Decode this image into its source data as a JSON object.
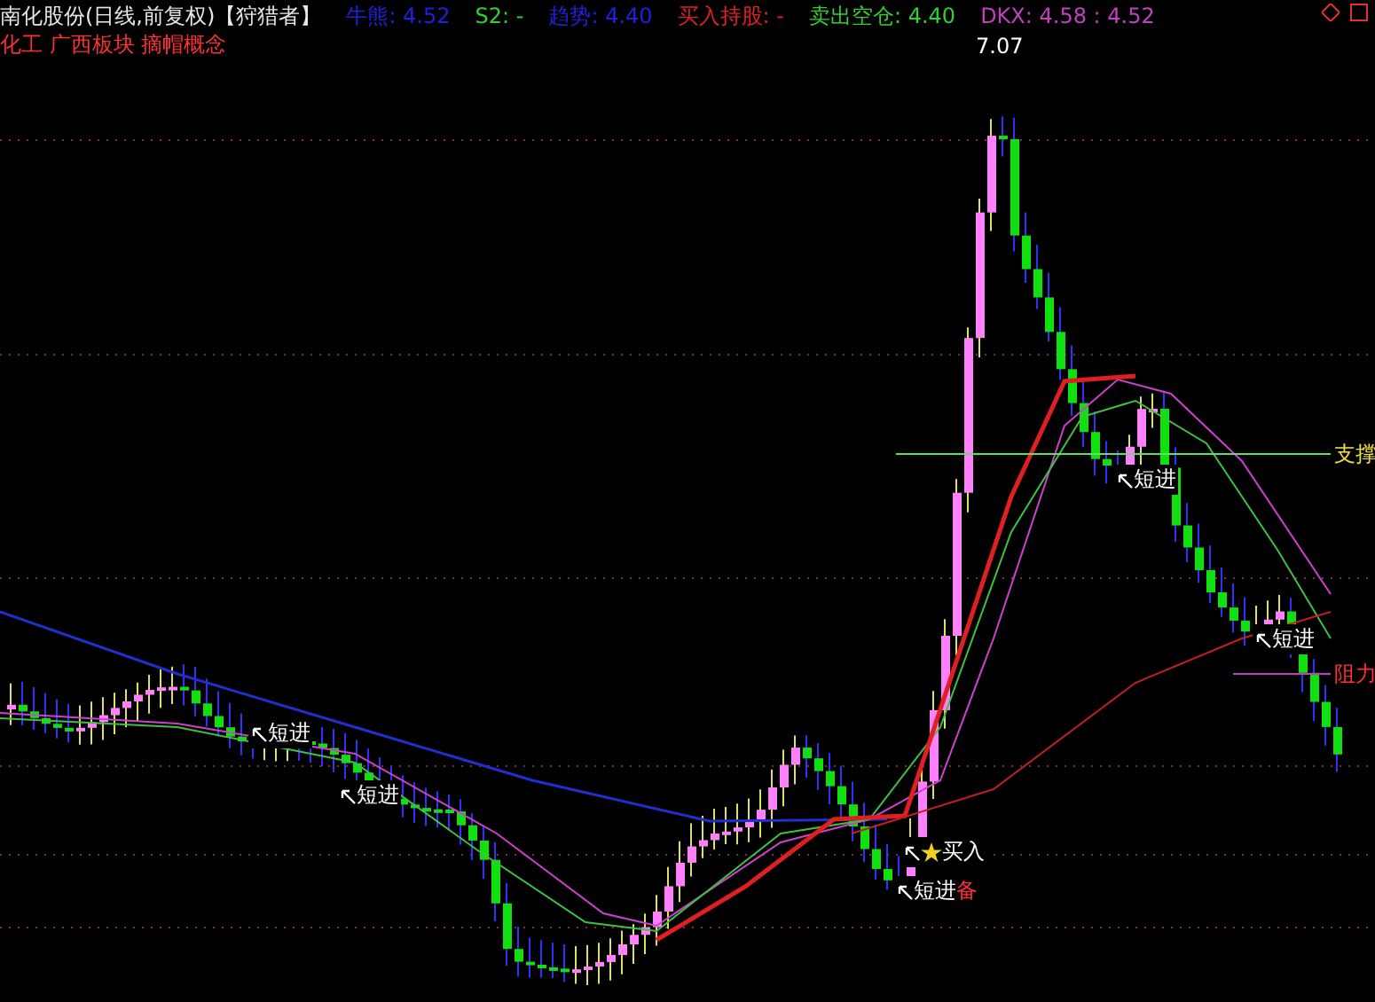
{
  "header": {
    "title": "南化股份(日线,前复权)【狩猎者】",
    "indicators": [
      {
        "label": "牛熊: 4.52",
        "color": "#2020e0"
      },
      {
        "label": "S2: -",
        "color": "#30d030"
      },
      {
        "label": "趋势: 4.40",
        "color": "#2020e0"
      },
      {
        "label": "买入持股: -",
        "color": "#e02020"
      },
      {
        "label": "卖出空仓: 4.40",
        "color": "#30d030"
      },
      {
        "label": "DKX: 4.58 : 4.52",
        "color": "#c040c0"
      }
    ],
    "concepts": "化工 广西板块 摘帽概念"
  },
  "chart": {
    "high_label": "7.07",
    "levels": [
      {
        "kind": "support",
        "label": "支撑"
      },
      {
        "kind": "resistance",
        "label": "阻力"
      }
    ],
    "signals": [
      {
        "kind": "short",
        "label": "短进"
      },
      {
        "kind": "short",
        "label": "短进"
      },
      {
        "kind": "short",
        "label": "短进"
      },
      {
        "kind": "short",
        "label": "短进"
      },
      {
        "kind": "buy",
        "label": "买入"
      },
      {
        "kind": "reserve",
        "label": "短进",
        "suffix": "备"
      }
    ]
  }
}
